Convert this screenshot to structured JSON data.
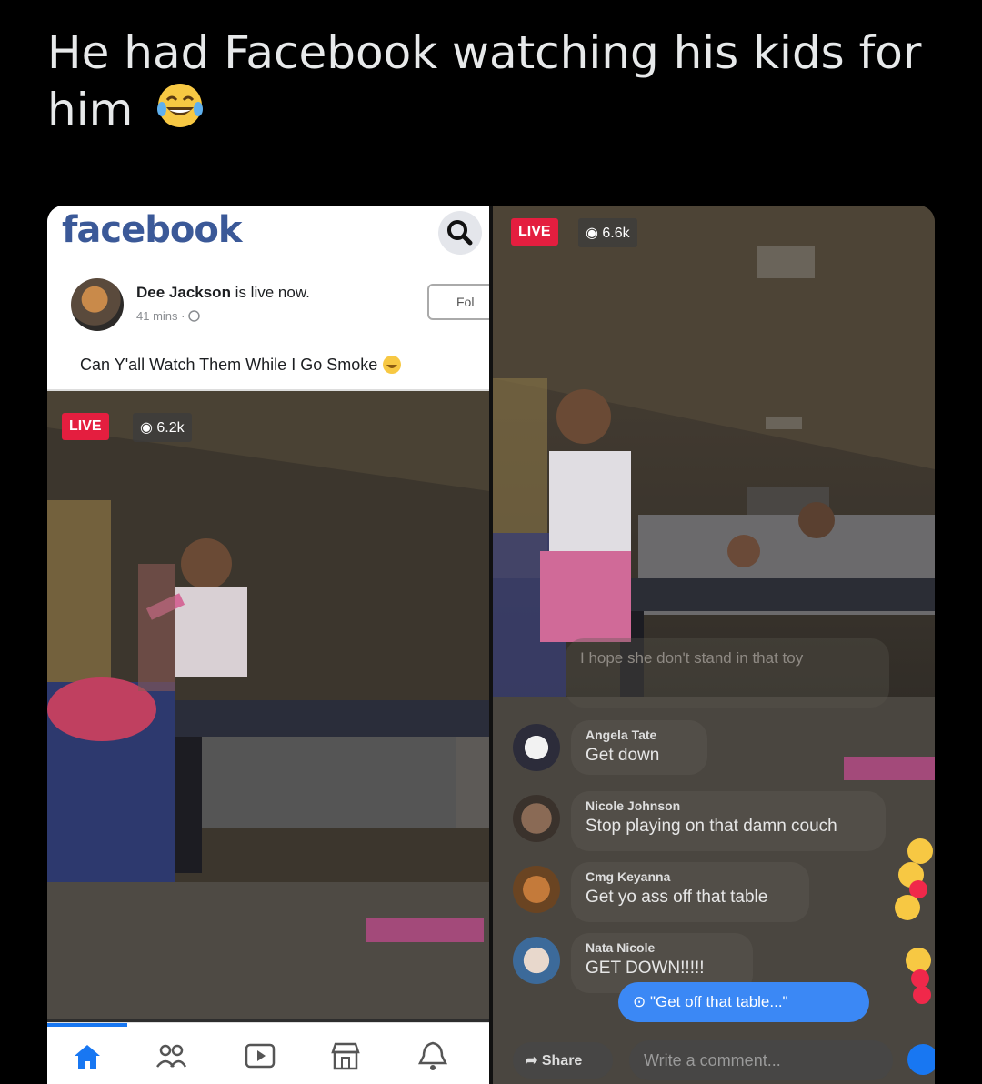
{
  "tweet": {
    "text": "He had Facebook watching his kids for him",
    "emoji": "face-with-tears-of-joy"
  },
  "left_screen": {
    "logo": "facebook",
    "post": {
      "author": "Dee Jackson",
      "status_suffix": " is live now.",
      "meta": "41 mins · ",
      "follow_label": "Fol",
      "caption": "Can Y'all Watch Them While I Go Smoke"
    },
    "video": {
      "live_label": "LIVE",
      "views": "6.2k"
    },
    "nav": [
      "home-icon",
      "friends-icon",
      "watch-icon",
      "marketplace-icon",
      "notifications-icon"
    ],
    "colors": {
      "brand": "#3b5998",
      "live": "#e41e3f",
      "active": "#1877f2"
    }
  },
  "right_screen": {
    "live_label": "LIVE",
    "views": "6.6k",
    "partial_comment": "I hope she don't stand in that toy",
    "comments": [
      {
        "name": "Angela Tate",
        "text": "Get down"
      },
      {
        "name": "Nicole Johnson",
        "text": "Stop playing on that damn couch"
      },
      {
        "name": "Cmg Keyanna",
        "text": "Get yo ass off that table"
      },
      {
        "name": "Nata Nicole",
        "text": "GET DOWN!!!!!"
      }
    ],
    "quick_reply": "\"Get off that table...\"",
    "share_label": "Share",
    "comment_placeholder": "Write a comment..."
  }
}
